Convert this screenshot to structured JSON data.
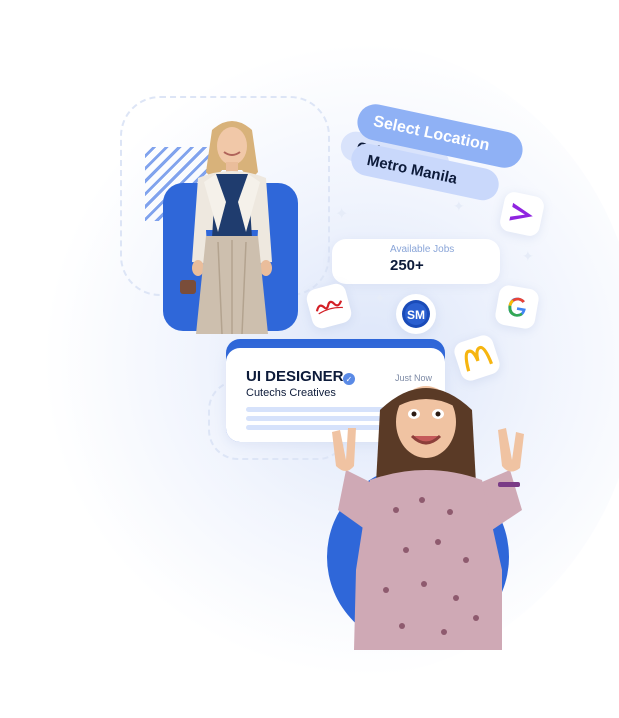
{
  "locations": {
    "title": "Select Location",
    "options": [
      "Cebu",
      "Metro Manila"
    ]
  },
  "jobs_widget": {
    "label": "Available Jobs",
    "count": "250+"
  },
  "company_logos": [
    "accenture-logo",
    "coca-cola-logo",
    "sm-logo",
    "google-logo",
    "mcdonalds-logo"
  ],
  "job_card": {
    "title": "UI DESIGNER",
    "company": "Cutechs Creatives",
    "posted": "Just Now"
  },
  "colors": {
    "brand_blue": "#2f67d9",
    "pill_blue": "#8fb1f5",
    "text_dark": "#0d1b3a"
  }
}
